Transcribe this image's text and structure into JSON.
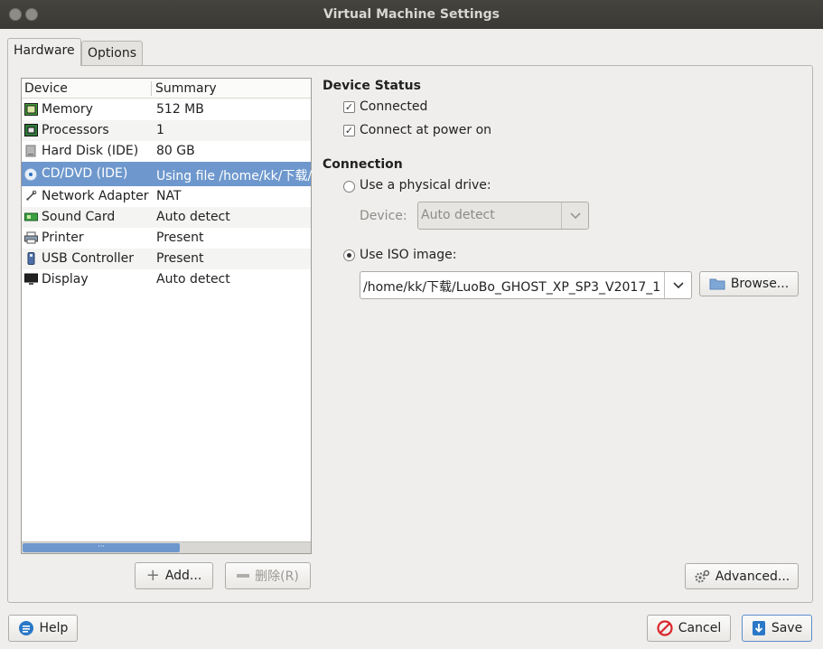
{
  "window": {
    "title": "Virtual Machine Settings"
  },
  "tabs": [
    {
      "label": "Hardware",
      "active": true
    },
    {
      "label": "Options",
      "active": false
    }
  ],
  "device_list": {
    "columns": [
      "Device",
      "Summary"
    ],
    "rows": [
      {
        "device": "Memory",
        "summary": "512 MB",
        "icon": "memory-icon"
      },
      {
        "device": "Processors",
        "summary": "1",
        "icon": "processor-icon"
      },
      {
        "device": "Hard Disk (IDE)",
        "summary": "80 GB",
        "icon": "hard-disk-icon"
      },
      {
        "device": "CD/DVD (IDE)",
        "summary": "Using file /home/kk/下载/LuoBo",
        "icon": "cd-dvd-icon",
        "selected": true
      },
      {
        "device": "Network Adapter",
        "summary": "NAT",
        "icon": "network-adapter-icon"
      },
      {
        "device": "Sound Card",
        "summary": "Auto detect",
        "icon": "sound-card-icon"
      },
      {
        "device": "Printer",
        "summary": "Present",
        "icon": "printer-icon"
      },
      {
        "device": "USB Controller",
        "summary": "Present",
        "icon": "usb-icon"
      },
      {
        "device": "Display",
        "summary": "Auto detect",
        "icon": "display-icon"
      }
    ]
  },
  "list_buttons": {
    "add": "Add...",
    "remove": "删除(R)"
  },
  "device_status": {
    "title": "Device Status",
    "connected": {
      "label": "Connected",
      "checked": true
    },
    "connect_at_power_on": {
      "label": "Connect at power on",
      "checked": true
    }
  },
  "connection": {
    "title": "Connection",
    "physical_drive": {
      "label": "Use a physical drive:",
      "selected": false
    },
    "device_label": "Device:",
    "device_value": "Auto detect",
    "iso_image": {
      "label": "Use ISO image:",
      "selected": true
    },
    "iso_path": "/home/kk/下载/LuoBo_GHOST_XP_SP3_V2017_1",
    "browse": "Browse..."
  },
  "advanced_button": "Advanced...",
  "footer": {
    "help": "Help",
    "cancel": "Cancel",
    "save": "Save"
  },
  "colors": {
    "selection": "#6e98cd",
    "titlebar": "#3f3e3a",
    "cancel_icon": "#d9262c",
    "save_icon": "#2a78c8"
  }
}
